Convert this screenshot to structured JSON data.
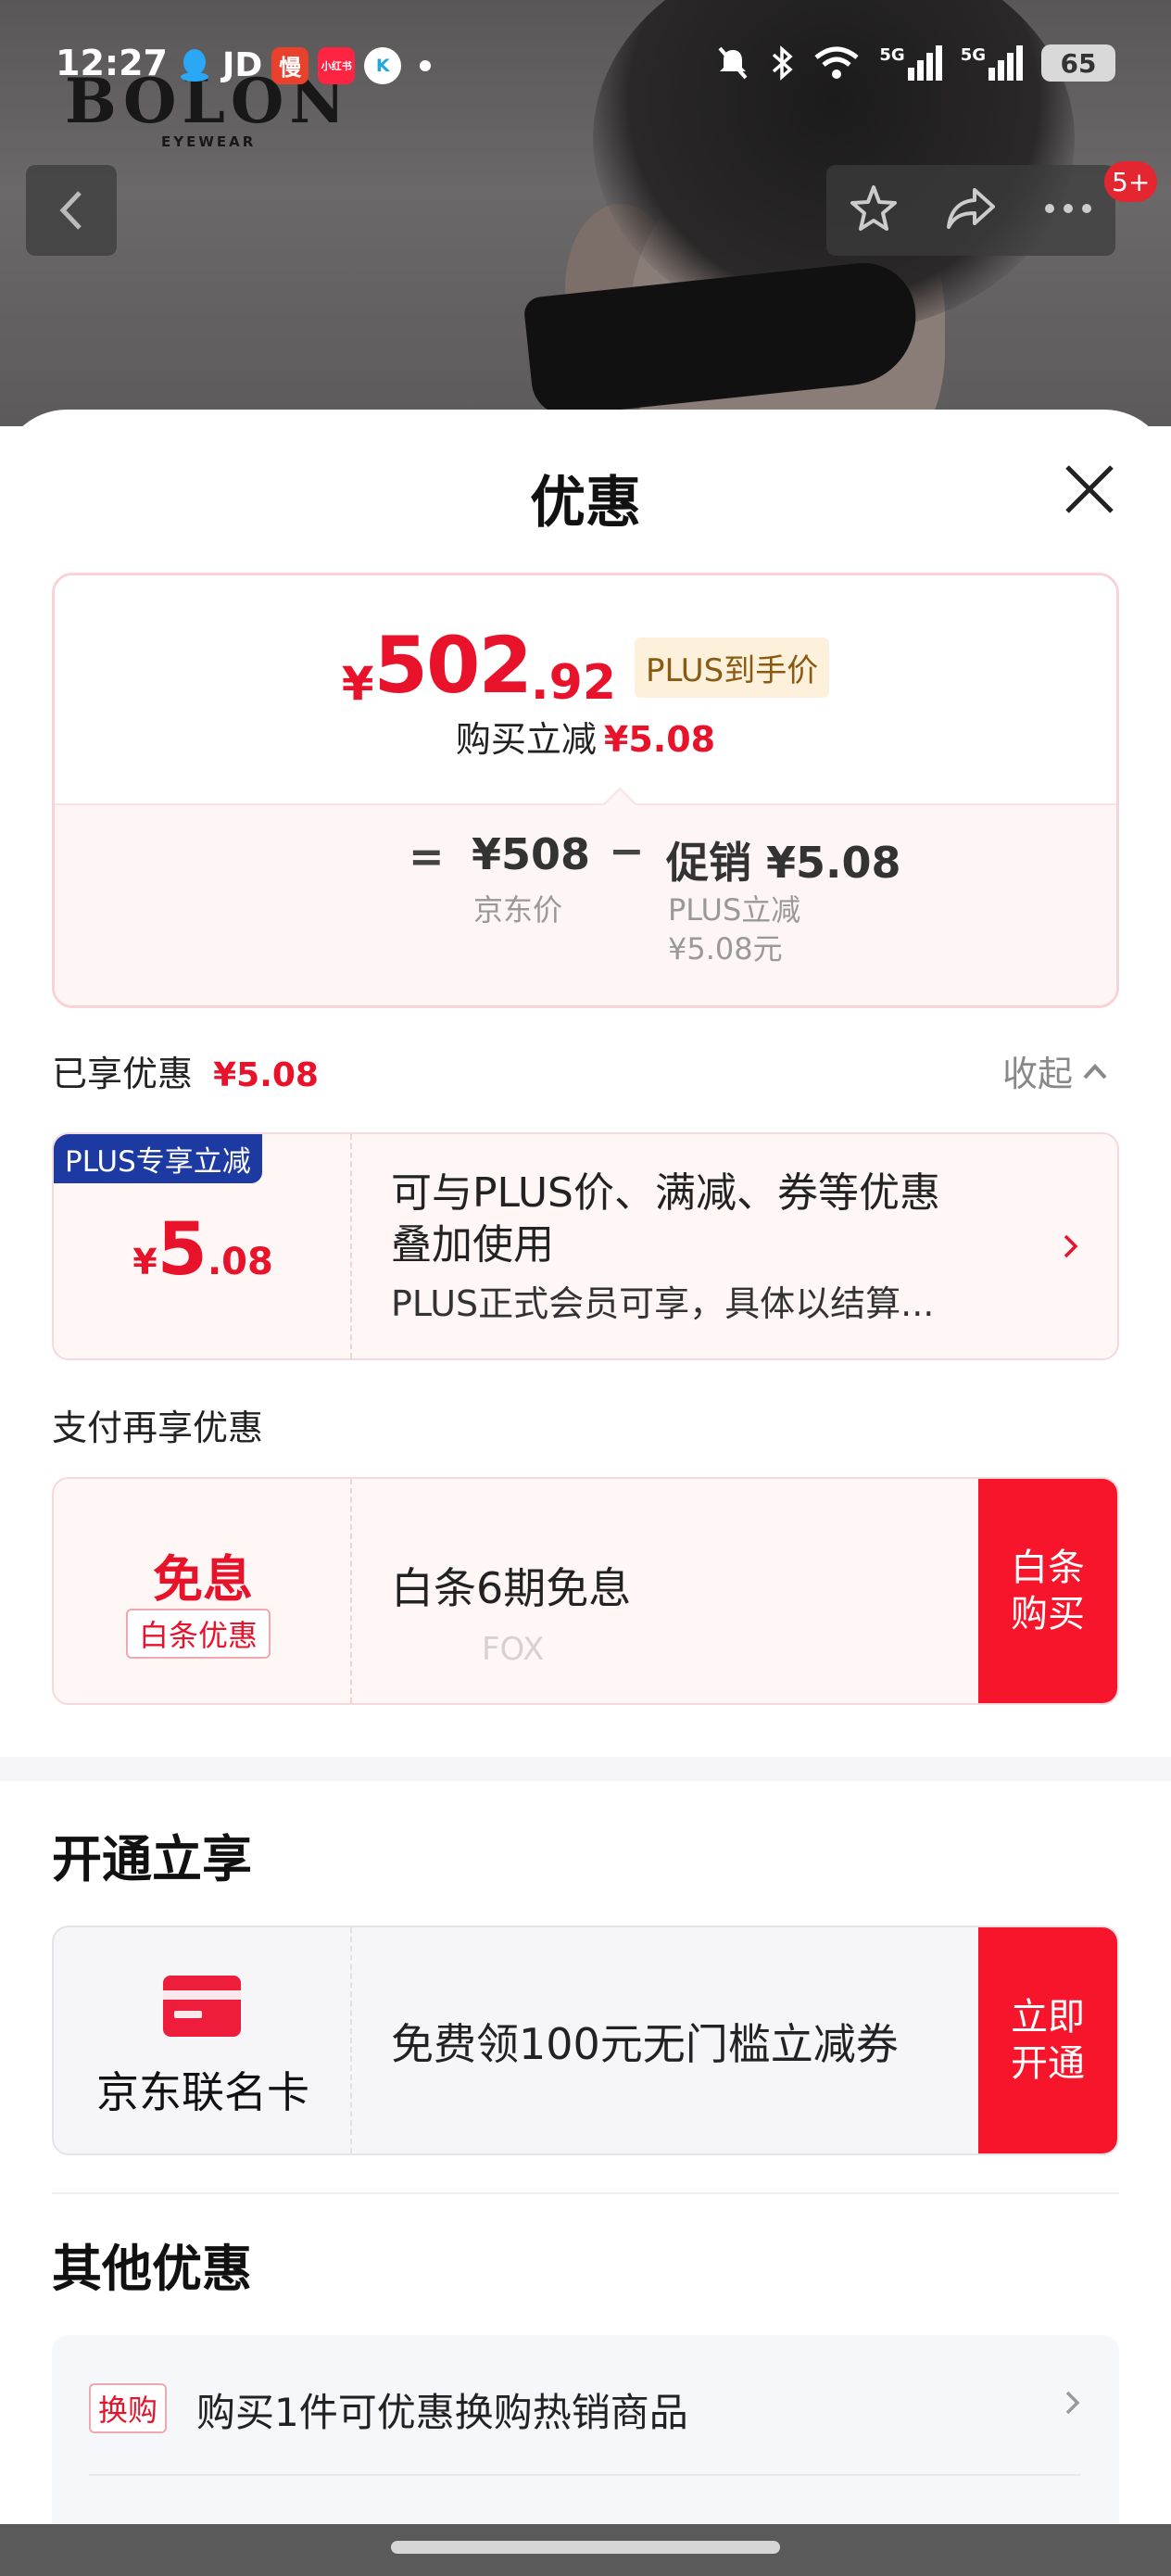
{
  "status_bar": {
    "time": "12:27",
    "carrier_text": "JD",
    "app_icons": [
      {
        "name": "qq-icon",
        "label": "",
        "color": "#2aa7f5"
      },
      {
        "name": "manbuy-icon",
        "label": "慢",
        "color": "#e9412b"
      },
      {
        "name": "xiaohongshu-icon",
        "label": "小红书",
        "color": "#ff2442"
      },
      {
        "name": "k-app-icon",
        "label": "K",
        "color": "#1fa5e0"
      }
    ],
    "network_1": "5G",
    "network_2": "5G",
    "battery": "65"
  },
  "product_image": {
    "brand": "BOLON",
    "brand_sub": "EYEWEAR"
  },
  "nav": {
    "message_badge": "5+"
  },
  "sheet": {
    "title": "优惠",
    "price": {
      "symbol": "¥",
      "integer": "502",
      "decimal": ".92",
      "tag": "PLUS到手价",
      "sub_label": "购买立减",
      "sub_value": "¥5.08",
      "formula": {
        "equals": "=",
        "jd_price": "¥508",
        "jd_price_label": "京东价",
        "minus": "−",
        "promo": "促销 ¥5.08",
        "promo_label_1": "PLUS立减",
        "promo_label_2": "¥5.08元"
      }
    },
    "enjoyed": {
      "label": "已享优惠",
      "value": "¥5.08",
      "collapse_label": "收起"
    },
    "plus_coupon": {
      "flag": "PLUS专享立减",
      "amount_symbol": "¥",
      "amount_int": "5",
      "amount_dec": ".08",
      "title_line_1": "可与PLUS价、满减、券等优惠",
      "title_line_2": "叠加使用",
      "desc": "PLUS正式会员可享，具体以结算..."
    },
    "pay_section": {
      "label": "支付再享优惠",
      "interest_title": "免息",
      "interest_tag": "白条优惠",
      "text": "白条6期免息",
      "button_line_1": "白条",
      "button_line_2": "购买"
    },
    "open_section": {
      "title": "开通立享",
      "card_name": "京东联名卡",
      "text": "免费领100元无门槛立减券",
      "button_line_1": "立即",
      "button_line_2": "开通"
    },
    "other_section": {
      "title": "其他优惠",
      "swap_tag": "换购",
      "swap_text": "购买1件可优惠换购热销商品"
    },
    "watermark": "FOX"
  },
  "colors": {
    "accent_red": "#e8132b",
    "button_red": "#f7152c",
    "plus_blue": "#1d3aa3",
    "plus_gold_bg": "#fdf1dc"
  }
}
